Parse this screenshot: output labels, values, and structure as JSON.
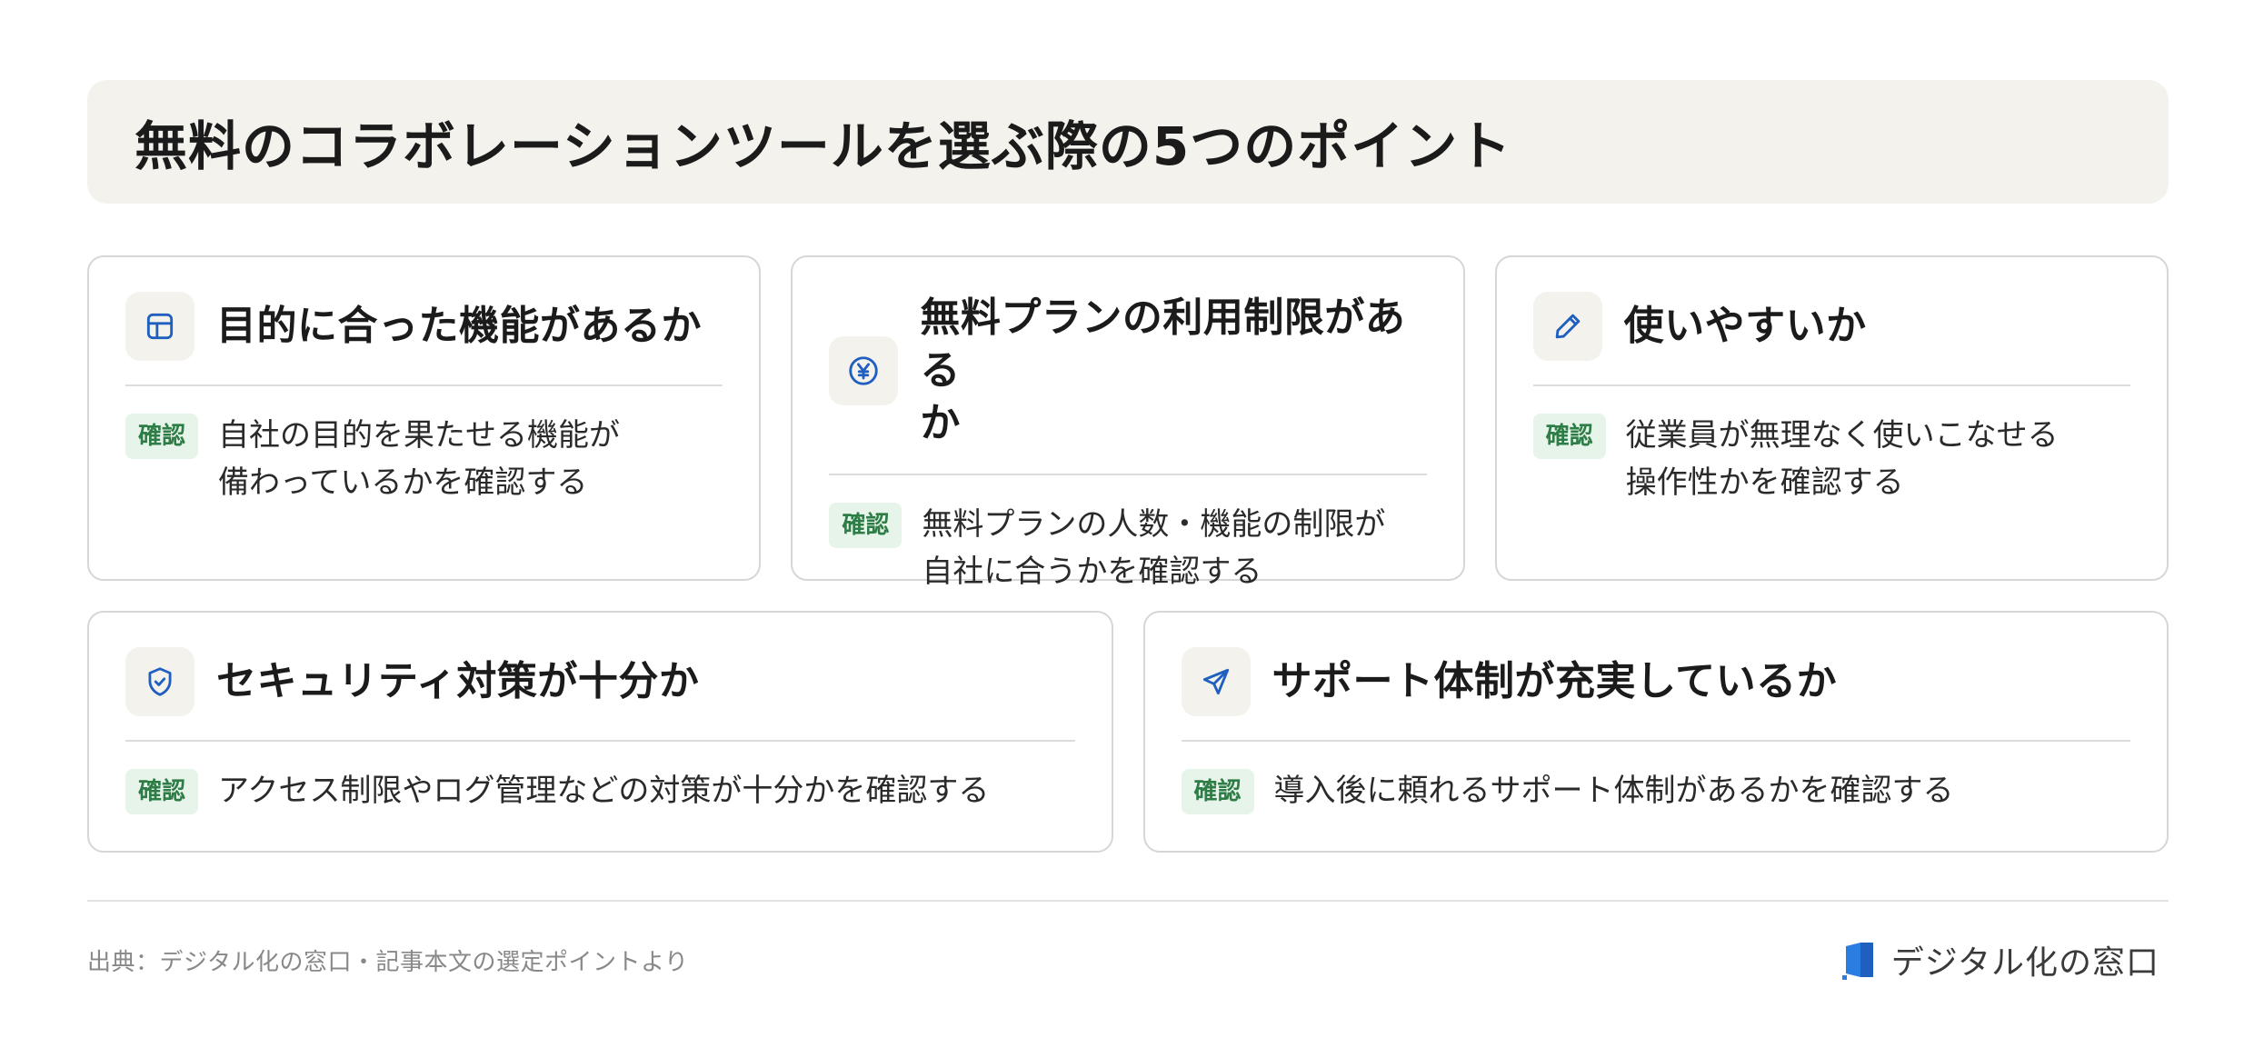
{
  "title": "無料のコラボレーションツールを選ぶ際の5つのポイント",
  "badge_label": "確認",
  "cards": [
    {
      "icon": "layout-grid-icon",
      "title": "目的に合った機能があるか",
      "text": "自社の目的を果たせる機能が\n備わっているかを確認する"
    },
    {
      "icon": "yen-circle-icon",
      "title": "無料プランの利用制限がある\nか",
      "text": "無料プランの人数・機能の制限が\n自社に合うかを確認する"
    },
    {
      "icon": "pencil-icon",
      "title": "使いやすいか",
      "text": "従業員が無理なく使いこなせる\n操作性かを確認する"
    },
    {
      "icon": "shield-check-icon",
      "title": "セキュリティ対策が十分か",
      "text": "アクセス制限やログ管理などの対策が十分かを確認する"
    },
    {
      "icon": "send-icon",
      "title": "サポート体制が充実しているか",
      "text": "導入後に頼れるサポート体制があるかを確認する"
    }
  ],
  "footer": {
    "source": "出典：デジタル化の窓口・記事本文の選定ポイントより",
    "brand": "デジタル化の窓口"
  },
  "colors": {
    "icon_blue": "#1f5fbf",
    "badge_bg": "#e7f4ea",
    "badge_text": "#2e7d46",
    "title_bg": "#f4f2ec"
  }
}
